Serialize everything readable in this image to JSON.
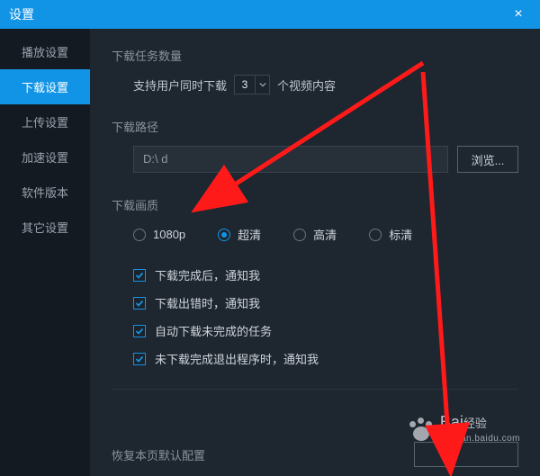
{
  "window": {
    "title": "设置",
    "close_icon": "×"
  },
  "sidebar": {
    "items": [
      {
        "label": "播放设置"
      },
      {
        "label": "下载设置",
        "active": true
      },
      {
        "label": "上传设置"
      },
      {
        "label": "加速设置"
      },
      {
        "label": "软件版本"
      },
      {
        "label": "其它设置"
      }
    ]
  },
  "download": {
    "count_section": "下载任务数量",
    "support_prefix": "支持用户同时下载",
    "count_value": "3",
    "support_suffix": "个视频内容",
    "path_section": "下载路径",
    "path_value": "D:\\                                                       d",
    "browse_label": "浏览...",
    "quality_section": "下载画质",
    "quality_options": [
      {
        "label": "1080p",
        "selected": false
      },
      {
        "label": "超清",
        "selected": true
      },
      {
        "label": "高清",
        "selected": false
      },
      {
        "label": "标清",
        "selected": false
      }
    ],
    "checks": [
      {
        "label": "下载完成后，通知我",
        "checked": true
      },
      {
        "label": "下载出错时，通知我",
        "checked": true
      },
      {
        "label": "自动下载未完成的任务",
        "checked": true
      },
      {
        "label": "未下载完成退出程序时，通知我",
        "checked": true
      }
    ]
  },
  "footer": {
    "restore_label": "恢复本页默认配置",
    "footer_button": " "
  },
  "brand": {
    "name_cn": "经验",
    "name_en": "Bai",
    "url": "jingyan.baidu.com"
  },
  "annotation": {
    "note": "Red arrows are external annotations pointing at the quality radio and the footer button."
  }
}
